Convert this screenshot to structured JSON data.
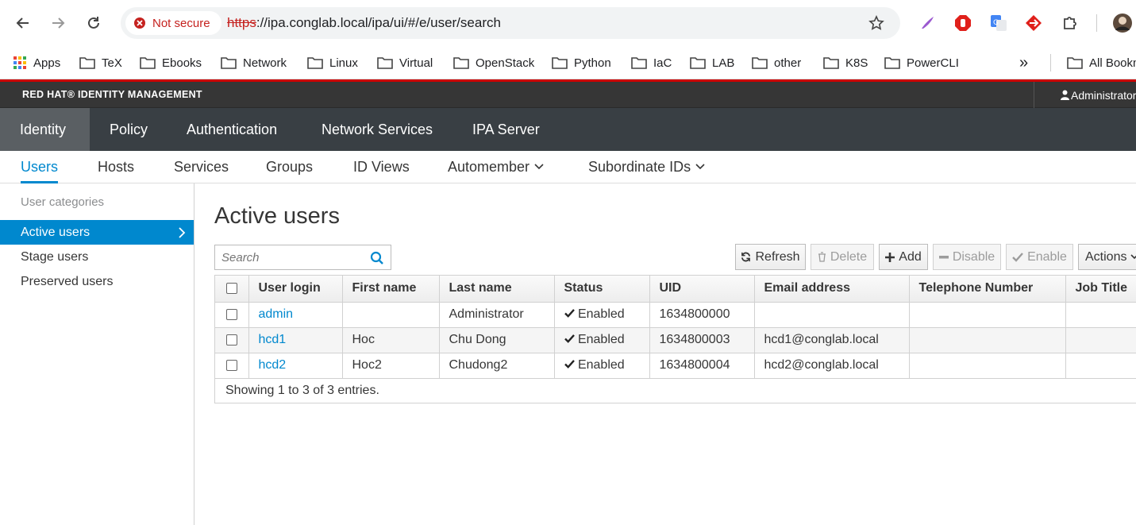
{
  "browser": {
    "security_label": "Not secure",
    "url_scheme": "https",
    "url_rest": "://ipa.conglab.local/ipa/ui/#/e/user/search",
    "bookmarks": [
      "Apps",
      "TeX",
      "Ebooks",
      "Network",
      "Linux",
      "Virtual",
      "OpenStack",
      "Python",
      "IaC",
      "LAB",
      "other",
      "K8S",
      "PowerCLI"
    ],
    "all_bookmarks": "All Bookmarks",
    "overflow": "»"
  },
  "app": {
    "brand": "RED HAT® IDENTITY MANAGEMENT",
    "user": "Administrator",
    "primary_nav": [
      "Identity",
      "Policy",
      "Authentication",
      "Network Services",
      "IPA Server"
    ],
    "secondary_nav": [
      "Users",
      "Hosts",
      "Services",
      "Groups",
      "ID Views",
      "Automember",
      "Subordinate IDs"
    ]
  },
  "sidebar": {
    "title": "User categories",
    "items": [
      "Active users",
      "Stage users",
      "Preserved users"
    ]
  },
  "main": {
    "title": "Active users",
    "search_placeholder": "Search",
    "buttons": {
      "refresh": "Refresh",
      "delete": "Delete",
      "add": "Add",
      "disable": "Disable",
      "enable": "Enable",
      "actions": "Actions"
    },
    "columns": [
      "User login",
      "First name",
      "Last name",
      "Status",
      "UID",
      "Email address",
      "Telephone Number",
      "Job Title"
    ],
    "rows": [
      {
        "login": "admin",
        "first": "",
        "last": "Administrator",
        "status": "Enabled",
        "uid": "1634800000",
        "email": "",
        "phone": "",
        "job": ""
      },
      {
        "login": "hcd1",
        "first": "Hoc",
        "last": "Chu Dong",
        "status": "Enabled",
        "uid": "1634800003",
        "email": "hcd1@conglab.local",
        "phone": "",
        "job": ""
      },
      {
        "login": "hcd2",
        "first": "Hoc2",
        "last": "Chudong2",
        "status": "Enabled",
        "uid": "1634800004",
        "email": "hcd2@conglab.local",
        "phone": "",
        "job": ""
      }
    ],
    "footer": "Showing 1 to 3 of 3 entries."
  },
  "colors": {
    "accent": "#0088ce",
    "masthead": "#363636",
    "primary_nav": "#393f44"
  }
}
